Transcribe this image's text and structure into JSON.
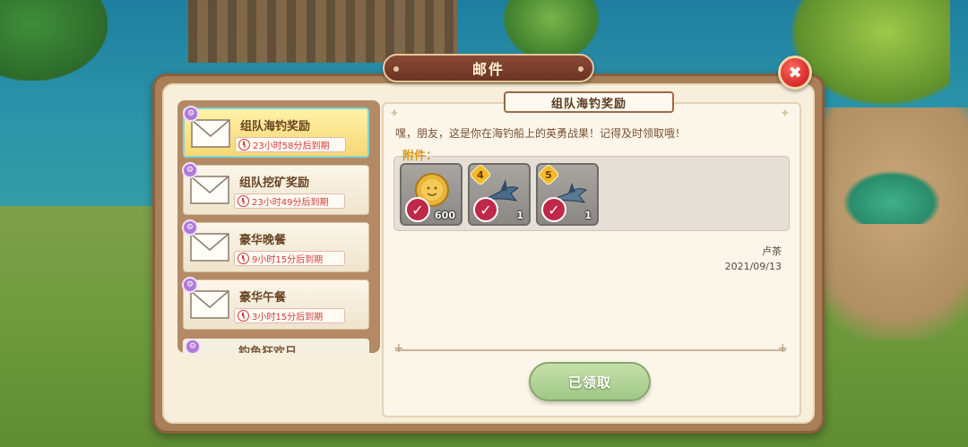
{
  "window": {
    "title": "邮件"
  },
  "close_icon": "close-icon",
  "mail_list": [
    {
      "title": "组队海钓奖励",
      "expires": "23小时58分后到期",
      "selected": true
    },
    {
      "title": "组队挖矿奖励",
      "expires": "23小时49分后到期",
      "selected": false
    },
    {
      "title": "豪华晚餐",
      "expires": "9小时15分后到期",
      "selected": false
    },
    {
      "title": "豪华午餐",
      "expires": "3小时15分后到期",
      "selected": false
    },
    {
      "title": "钓鱼狂欢日",
      "expires": "",
      "selected": false
    }
  ],
  "detail": {
    "title": "组队海钓奖励",
    "message": "嘿，朋友，这是你在海钓船上的英勇战果！记得及时领取哦！",
    "attachments_label": "附件：",
    "attachments": [
      {
        "name": "coin",
        "quantity": "600",
        "star": "",
        "claimed": true
      },
      {
        "name": "swordfish",
        "quantity": "1",
        "star": "4",
        "claimed": true
      },
      {
        "name": "swordfish",
        "quantity": "1",
        "star": "5",
        "claimed": true
      }
    ],
    "sender": "卢茶",
    "date": "2021/09/13",
    "claim_button": "已领取"
  },
  "colors": {
    "accent_title": "#6b3323",
    "timer_red": "#d23c3c",
    "claimed_red": "#c02848",
    "button_green": "#9fc888",
    "selected_yellow": "#f7d772"
  }
}
